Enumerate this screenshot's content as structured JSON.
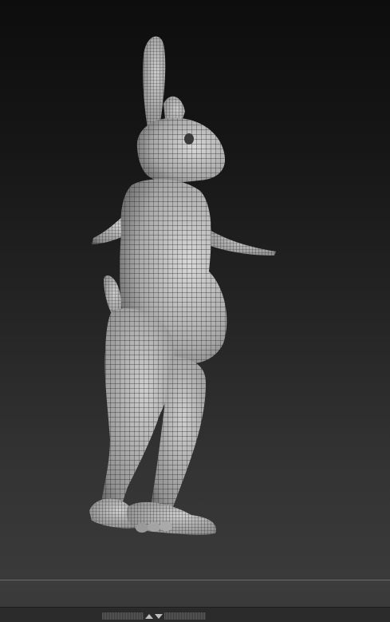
{
  "app": {
    "viewport": {
      "background_top": "#0d0d0d",
      "background_bottom": "#3a3a3a",
      "model": {
        "subject": "rabbit-character",
        "display_mode": "polyframe-wireframe",
        "material_color": "#b4b4b4",
        "wire_color": "#2a2a2a"
      }
    },
    "bottom_tray": {
      "handle_icon": "tray-drag-handle-icon",
      "toggle_icons": [
        "triangle-up-icon",
        "triangle-down-icon"
      ]
    }
  }
}
